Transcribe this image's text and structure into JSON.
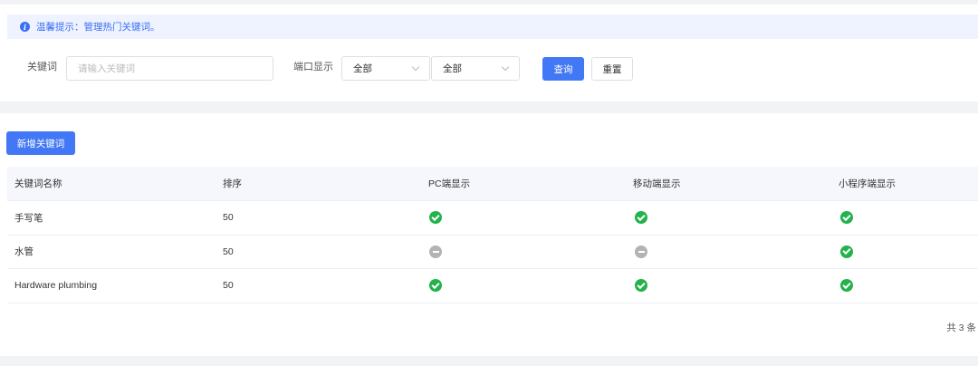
{
  "tip": {
    "text": "温馨提示：管理热门关键词。"
  },
  "filters": {
    "keyword_label": "关键词",
    "keyword_placeholder": "请输入关键词",
    "display_label": "端口显示",
    "select1_value": "全部",
    "select2_value": "全部",
    "query_button": "查询",
    "reset_button": "重置"
  },
  "actions": {
    "add_button": "新增关键词"
  },
  "table": {
    "headers": [
      "关键词名称",
      "排序",
      "PC端显示",
      "移动端显示",
      "小程序端显示"
    ],
    "rows": [
      {
        "name": "手写笔",
        "sort": "50",
        "pc": "enabled",
        "mobile": "enabled",
        "mini": "enabled"
      },
      {
        "name": "水管",
        "sort": "50",
        "pc": "disabled",
        "mobile": "disabled",
        "mini": "enabled"
      },
      {
        "name": "Hardware plumbing",
        "sort": "50",
        "pc": "enabled",
        "mobile": "enabled",
        "mini": "enabled"
      }
    ]
  },
  "pagination": {
    "total_text": "共 3 条"
  },
  "colors": {
    "primary": "#4278f5",
    "enabled": "#23b24b",
    "disabled": "#b3b3b3",
    "tip_bg": "#eef3ff"
  }
}
